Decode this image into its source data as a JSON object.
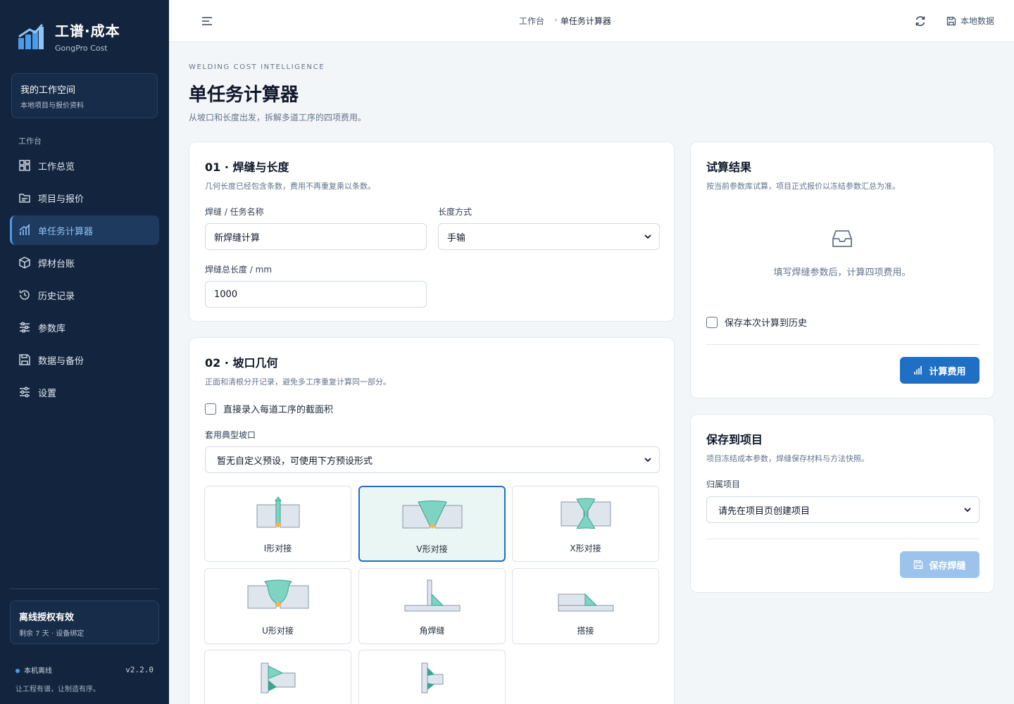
{
  "brand": {
    "name": "工谱·成本",
    "subtitle": "GongPro Cost"
  },
  "workspace": {
    "title": "我的工作空间",
    "subtitle": "本地项目与报价资料"
  },
  "sidebar": {
    "section_label": "工作台",
    "items": [
      {
        "label": "工作总览",
        "icon": "grid-icon"
      },
      {
        "label": "项目与报价",
        "icon": "folder-icon"
      },
      {
        "label": "单任务计算器",
        "icon": "chart-icon",
        "active": true
      },
      {
        "label": "焊材台账",
        "icon": "box-icon"
      },
      {
        "label": "历史记录",
        "icon": "history-icon"
      },
      {
        "label": "参数库",
        "icon": "sliders-icon"
      },
      {
        "label": "数据与备份",
        "icon": "save-icon"
      },
      {
        "label": "设置",
        "icon": "settings-icon"
      }
    ]
  },
  "license": {
    "title": "离线授权有效",
    "subtitle": "剩余 7 天 · 设备绑定"
  },
  "status": {
    "mode": "本机离线",
    "version": "v2.2.0",
    "tagline": "让工程有谱，让制造有序。"
  },
  "topbar": {
    "breadcrumb": [
      "工作台",
      "单任务计算器"
    ],
    "separator": "›",
    "local_data_label": "本地数据"
  },
  "page": {
    "eyebrow": "WELDING COST INTELLIGENCE",
    "title": "单任务计算器",
    "subtitle": "从坡口和长度出发，拆解多道工序的四项费用。"
  },
  "section1": {
    "title": "01 · 焊缝与长度",
    "subtitle": "几何长度已经包含条数，费用不再重复乘以条数。",
    "name_label": "焊缝 / 任务名称",
    "name_value": "新焊缝计算",
    "length_mode_label": "长度方式",
    "length_mode_value": "手输",
    "length_label": "焊缝总长度 / mm",
    "length_value": "1000"
  },
  "section2": {
    "title": "02 · 坡口几何",
    "subtitle": "正面和清根分开记录，避免多工序重复计算同一部分。",
    "direct_area_label": "直接录入每道工序的截面积",
    "preset_label": "套用典型坡口",
    "preset_value": "暂无自定义预设，可使用下方预设形式",
    "joints": [
      {
        "label": "I形对接",
        "selected": false
      },
      {
        "label": "V形对接",
        "selected": true
      },
      {
        "label": "X形对接",
        "selected": false
      },
      {
        "label": "U形对接",
        "selected": false
      },
      {
        "label": "角焊缝",
        "selected": false
      },
      {
        "label": "搭接",
        "selected": false
      },
      {
        "label": "",
        "selected": false
      },
      {
        "label": "",
        "selected": false
      }
    ]
  },
  "result": {
    "title": "试算结果",
    "subtitle": "按当前参数库试算，项目正式报价以冻结参数汇总为准。",
    "empty_text": "填写焊缝参数后，计算四项费用。",
    "save_history_label": "保存本次计算到历史",
    "calc_button": "计算费用"
  },
  "save_project": {
    "title": "保存到项目",
    "subtitle": "项目冻结成本参数，焊缝保存材料与方法快照。",
    "project_label": "归属项目",
    "project_value": "请先在项目页创建项目",
    "save_button": "保存焊缝"
  },
  "colors": {
    "sidebar_bg": "#13253e",
    "accent": "#1f6fc5",
    "weld_fill": "#7fd3c3",
    "root_fill": "#f2b45a"
  }
}
